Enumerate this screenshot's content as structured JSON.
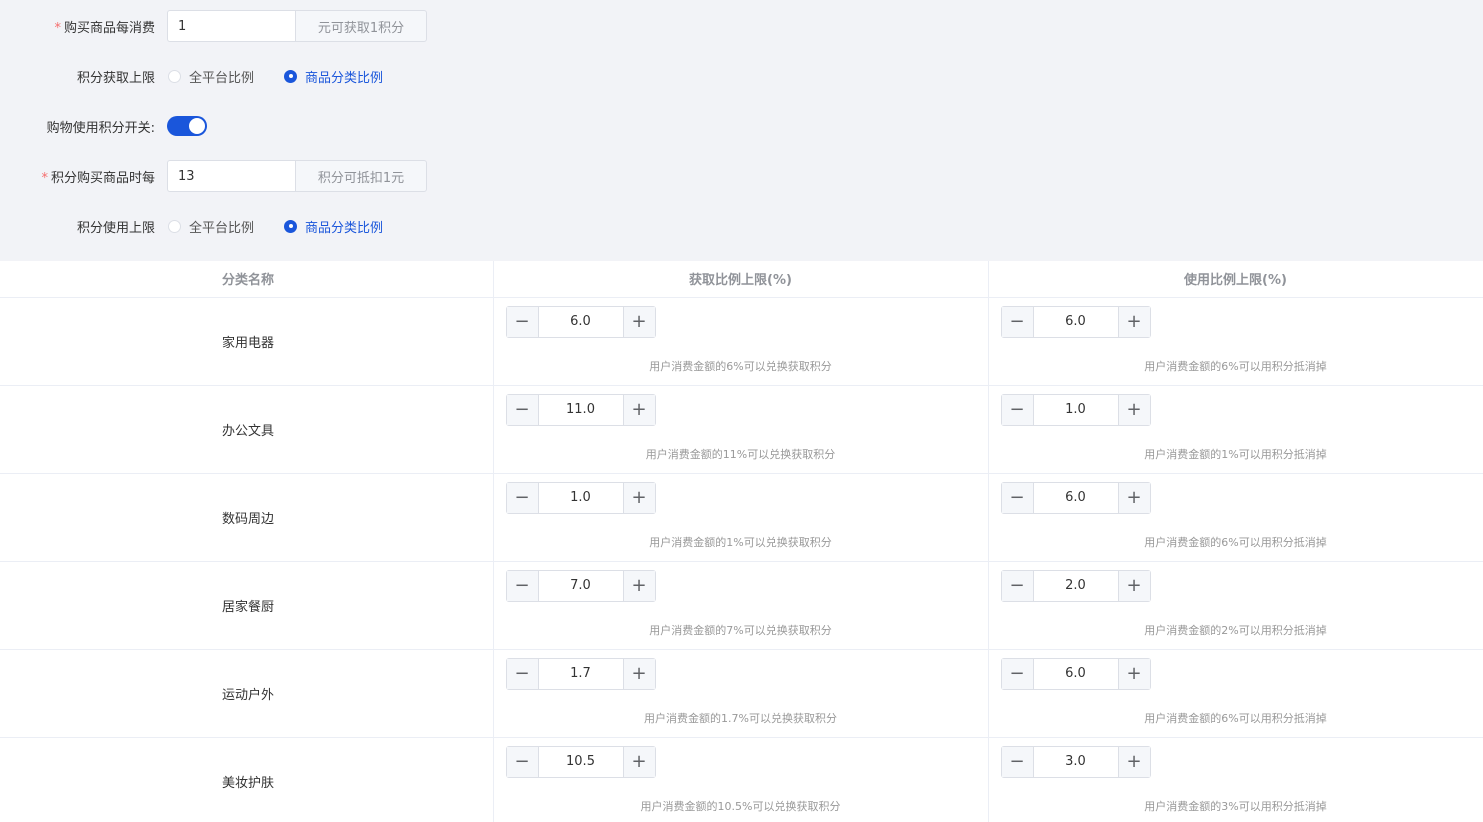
{
  "form": {
    "earn_rate": {
      "label": "购买商品每消费",
      "required_mark": "*",
      "value": "1",
      "suffix": "元可获取1积分"
    },
    "earn_limit": {
      "label": "积分获取上限",
      "options": [
        "全平台比例",
        "商品分类比例"
      ],
      "selected": "商品分类比例"
    },
    "use_switch": {
      "label": "购物使用积分开关:",
      "on": true
    },
    "use_rate": {
      "label": "积分购买商品时每",
      "required_mark": "*",
      "value": "13",
      "suffix": "积分可抵扣1元"
    },
    "use_limit": {
      "label": "积分使用上限",
      "options": [
        "全平台比例",
        "商品分类比例"
      ],
      "selected": "商品分类比例"
    }
  },
  "table": {
    "headers": [
      "分类名称",
      "获取比例上限(%)",
      "使用比例上限(%)"
    ],
    "rows": [
      {
        "name": "家用电器",
        "earn": "6.0",
        "earn_hint": "用户消费金额的6%可以兑换获取积分",
        "use": "6.0",
        "use_hint": "用户消费金额的6%可以用积分抵消掉"
      },
      {
        "name": "办公文具",
        "earn": "11.0",
        "earn_hint": "用户消费金额的11%可以兑换获取积分",
        "use": "1.0",
        "use_hint": "用户消费金额的1%可以用积分抵消掉"
      },
      {
        "name": "数码周边",
        "earn": "1.0",
        "earn_hint": "用户消费金额的1%可以兑换获取积分",
        "use": "6.0",
        "use_hint": "用户消费金额的6%可以用积分抵消掉"
      },
      {
        "name": "居家餐厨",
        "earn": "7.0",
        "earn_hint": "用户消费金额的7%可以兑换获取积分",
        "use": "2.0",
        "use_hint": "用户消费金额的2%可以用积分抵消掉"
      },
      {
        "name": "运动户外",
        "earn": "1.7",
        "earn_hint": "用户消费金额的1.7%可以兑换获取积分",
        "use": "6.0",
        "use_hint": "用户消费金额的6%可以用积分抵消掉"
      },
      {
        "name": "美妆护肤",
        "earn": "10.5",
        "earn_hint": "用户消费金额的10.5%可以兑换获取积分",
        "use": "3.0",
        "use_hint": "用户消费金额的3%可以用积分抵消掉"
      }
    ],
    "stepper_minus": "−",
    "stepper_plus": "+"
  },
  "colors": {
    "accent": "#1a56db",
    "required": "#f56c6c",
    "form_bg": "#f2f3f7"
  }
}
